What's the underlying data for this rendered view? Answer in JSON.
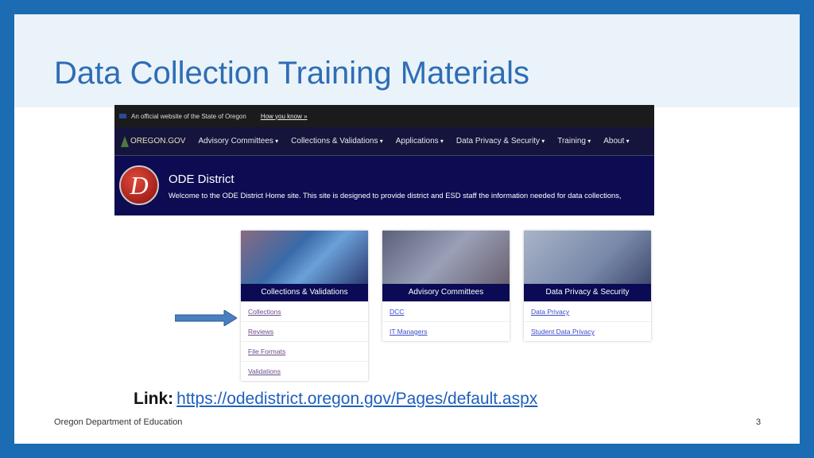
{
  "slide": {
    "title": "Data Collection Training Materials",
    "footer": "Oregon Department of Education",
    "page_number": "3",
    "link_label": "Link:",
    "link_url": "https://odedistrict.oregon.gov/Pages/default.aspx"
  },
  "site": {
    "official_text": "An official website of the State of Oregon",
    "how_you_know": "How you know »",
    "logo": "OREGON.GOV",
    "nav": [
      "Advisory Committees",
      "Collections & Validations",
      "Applications",
      "Data Privacy & Security",
      "Training",
      "About"
    ],
    "banner_title": "ODE District",
    "banner_logo_letter": "D",
    "banner_desc": "Welcome to the ODE District Home site.  This site is designed to provide district and ESD staff the information needed for data collections,",
    "cards": [
      {
        "title": "Collections & Validations",
        "links": [
          "Collections",
          "Reviews",
          "File Formats",
          "Validations"
        ]
      },
      {
        "title": "Advisory Committees",
        "links": [
          "DCC",
          "IT Managers"
        ]
      },
      {
        "title": "Data Privacy & Security",
        "links": [
          "Data Privacy",
          "Student Data Privacy"
        ]
      }
    ]
  },
  "colors": {
    "frame": "#1b6cb2",
    "title": "#2e6db4",
    "nav": "#14143c",
    "banner": "#0d0c52",
    "card_header": "#0a0a55",
    "arrow": "#4a7fc0"
  }
}
